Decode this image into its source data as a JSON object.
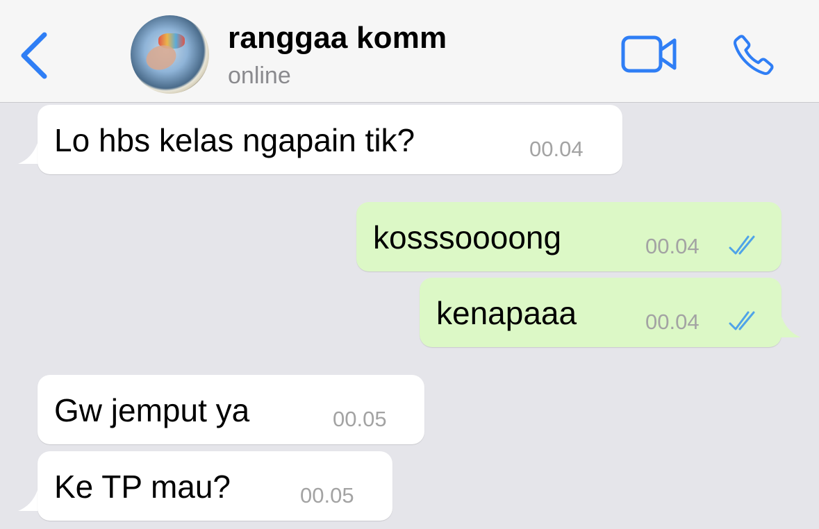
{
  "header": {
    "back_icon": "chevron-left-icon",
    "contact_name": "ranggaa komm",
    "status": "online",
    "video_icon": "video-camera-icon",
    "call_icon": "phone-icon",
    "accent_color": "#2f7ef5"
  },
  "messages": [
    {
      "direction": "incoming",
      "text": "Lo hbs kelas ngapain tik?",
      "time": "00.04"
    },
    {
      "direction": "outgoing",
      "text": "kosssoooong",
      "time": "00.04",
      "status": "read"
    },
    {
      "direction": "outgoing",
      "text": "kenapaaa",
      "time": "00.04",
      "status": "read"
    },
    {
      "direction": "incoming",
      "text": "Gw jemput ya",
      "time": "00.05"
    },
    {
      "direction": "incoming",
      "text": "Ke TP mau?",
      "time": "00.05"
    }
  ],
  "colors": {
    "incoming_bubble": "#ffffff",
    "outgoing_bubble": "#dcf8c6",
    "read_check": "#4fa3e8",
    "background": "#e5e5ea"
  }
}
